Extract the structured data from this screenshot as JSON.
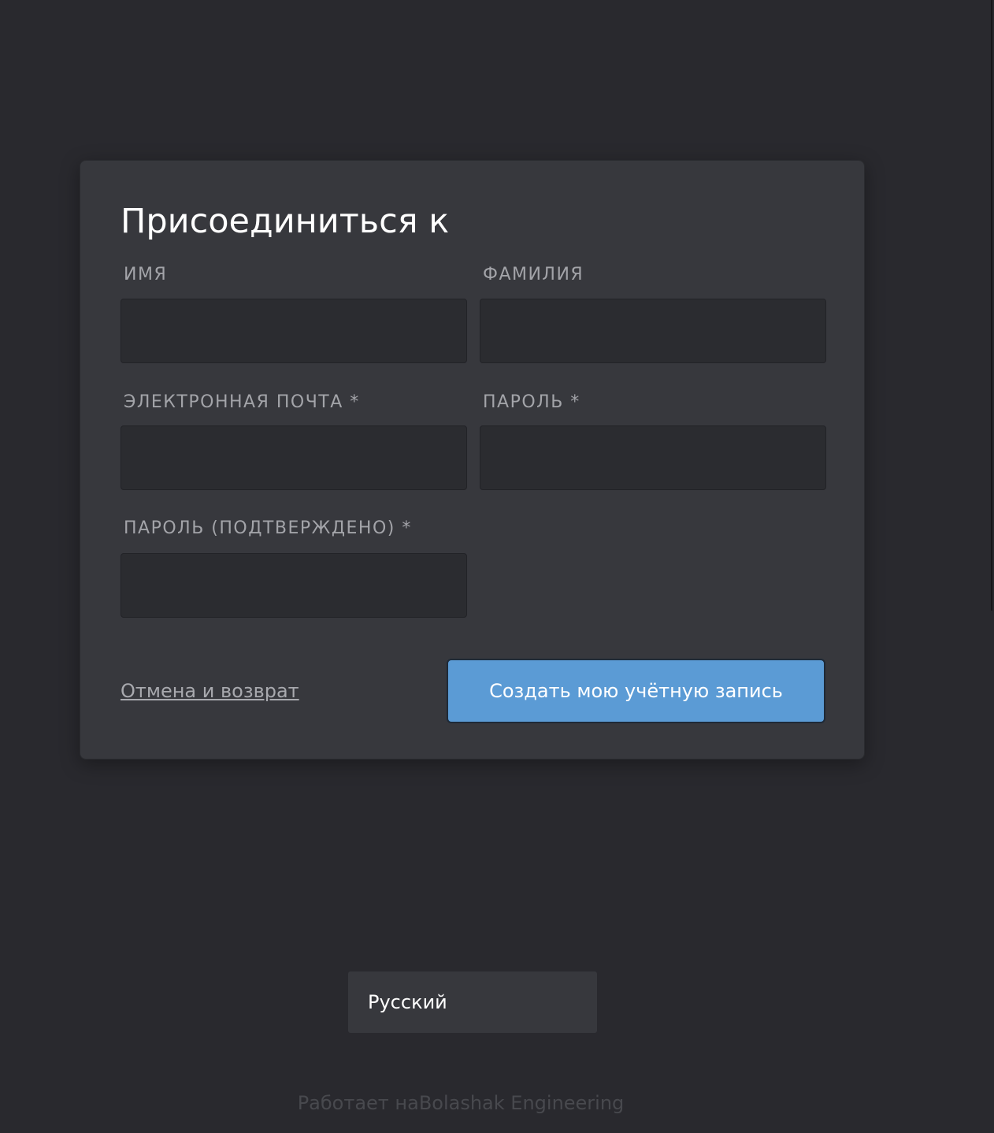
{
  "form": {
    "title": "Присоединиться к",
    "fields": {
      "first_name": {
        "label": "ИМЯ",
        "value": ""
      },
      "last_name": {
        "label": "ФАМИЛИЯ",
        "value": ""
      },
      "email": {
        "label": "ЭЛЕКТРОННАЯ ПОЧТА *",
        "value": ""
      },
      "password": {
        "label": "ПАРОЛЬ *",
        "value": ""
      },
      "password_confirm": {
        "label": "ПАРОЛЬ (ПОДТВЕРЖДЕНО) *",
        "value": ""
      }
    },
    "cancel_link": "Отмена и возврат",
    "submit_label": "Создать мою учётную запись"
  },
  "language": {
    "selected": "Русский"
  },
  "footer": {
    "powered_by": "Работает наBolashak Engineering"
  },
  "colors": {
    "background": "#29292e",
    "card": "#37383d",
    "input": "#2b2c30",
    "accent": "#5b9bd5",
    "label": "#a3a4a9"
  }
}
